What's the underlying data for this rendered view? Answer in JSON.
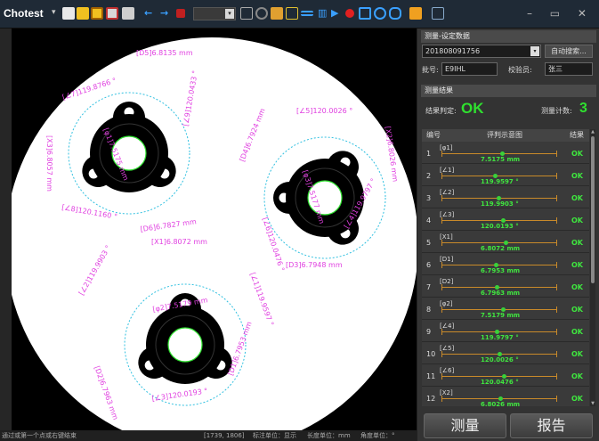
{
  "app": {
    "name": "Chotest",
    "dropdown_arrow": "▾"
  },
  "toolbar": {
    "zoom_arrow": "▾",
    "window_controls": "– ▭ ✕",
    "icons": [
      "open-icon",
      "image-icon",
      "calculator-icon",
      "export-icon",
      "window-icon",
      "arrow-left-icon",
      "arrow-right-icon",
      "stop-icon",
      "grid-icon",
      "zoom-icon",
      "settings-icon",
      "measure-icon",
      "play-icon",
      "record-icon",
      "camera-icon",
      "fit-icon",
      "layout-icon",
      "report-icon"
    ]
  },
  "colors": {
    "accent_ok": "#2fe02f",
    "annotation": "#e040e0",
    "fit_circle": "#30c0e0",
    "part": "#000000",
    "background": "#ffffff"
  },
  "canvas_labels": [
    "[D5]6.8135 mm",
    "[∠7]119.8766 °",
    "[φ1]7.5175 mm",
    "[X3]6.8057 mm",
    "[∠9]120.0433 °",
    "[∠8]120.1160 °",
    "[D6]6.7827 mm",
    "[∠5]120.0026 °",
    "[D4]6.7924 mm",
    "[X2]6.8026 mm",
    "[φ3]7.5177 mm",
    "[∠6]120.0476 °",
    "[∠4]119.9797 °",
    "[D3]6.7948 mm",
    "[X1]6.8072 mm",
    "[∠2]119.9903 °",
    "[∠1]119.9597 °",
    "[φ2]7.5179 mm",
    "[D2]6.7963 mm",
    "[D1]6.7953 mm",
    "[∠3]120.0193 °"
  ],
  "status": {
    "hint": "通过或第一个点或右键结束",
    "coords": "[1739, 1806]",
    "display_unit": "标注单位：显示",
    "length_unit": "长度单位：mm",
    "angle_unit": "角度单位：°"
  },
  "panel": {
    "setup_header": "测量-设定数据",
    "serial_value": "201808091756",
    "dropdown_arrow": "▾",
    "auto_search": "自动搜索...",
    "batch_label": "批号:",
    "batch_value": "E9IHL",
    "inspector_label": "校验员:",
    "inspector_value": "张三",
    "result_header": "测量结果",
    "verdict_label": "结果判定:",
    "verdict_value": "OK",
    "count_label": "测量计数:",
    "count_value": "3",
    "table_headers": {
      "index": "编号",
      "diagram": "评判示意图",
      "result": "结果"
    },
    "scroll_up": "▲",
    "scroll_down": "▼",
    "measure_button": "测量",
    "report_button": "报告"
  },
  "results": [
    {
      "index": "1",
      "name": "[φ1]",
      "value": "7.5175 mm",
      "result": "OK",
      "pos": 0.52
    },
    {
      "index": "2",
      "name": "[∠1]",
      "value": "119.9597 °",
      "result": "OK",
      "pos": 0.46
    },
    {
      "index": "3",
      "name": "[∠2]",
      "value": "119.9903 °",
      "result": "OK",
      "pos": 0.49
    },
    {
      "index": "4",
      "name": "[∠3]",
      "value": "120.0193 °",
      "result": "OK",
      "pos": 0.53
    },
    {
      "index": "5",
      "name": "[X1]",
      "value": "6.8072 mm",
      "result": "OK",
      "pos": 0.55
    },
    {
      "index": "6",
      "name": "[D1]",
      "value": "6.7953 mm",
      "result": "OK",
      "pos": 0.47
    },
    {
      "index": "7",
      "name": "[D2]",
      "value": "6.7963 mm",
      "result": "OK",
      "pos": 0.48
    },
    {
      "index": "8",
      "name": "[φ2]",
      "value": "7.5179 mm",
      "result": "OK",
      "pos": 0.53
    },
    {
      "index": "9",
      "name": "[∠4]",
      "value": "119.9797 °",
      "result": "OK",
      "pos": 0.48
    },
    {
      "index": "10",
      "name": "[∠5]",
      "value": "120.0026 °",
      "result": "OK",
      "pos": 0.5
    },
    {
      "index": "11",
      "name": "[∠6]",
      "value": "120.0476 °",
      "result": "OK",
      "pos": 0.54
    },
    {
      "index": "12",
      "name": "[X2]",
      "value": "6.8026 mm",
      "result": "OK",
      "pos": 0.51
    }
  ]
}
